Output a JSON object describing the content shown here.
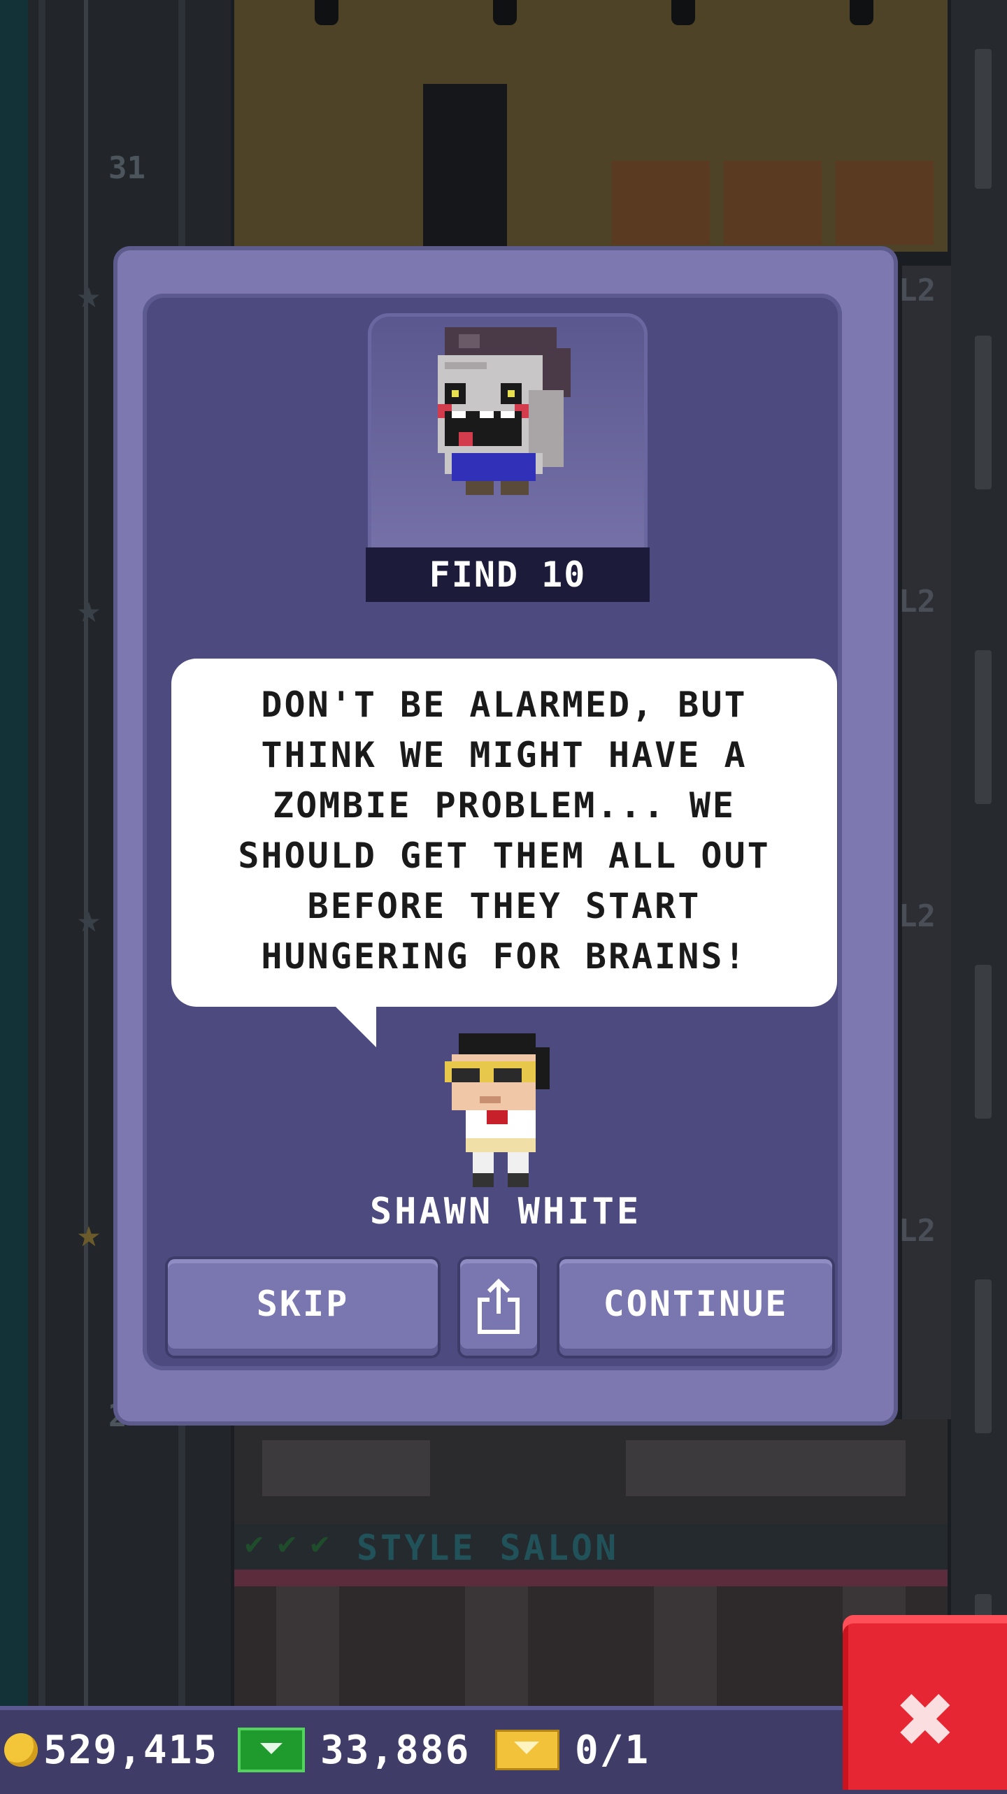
{
  "background": {
    "floor_numbers": [
      "31",
      "2"
    ],
    "level_tag": "L2",
    "room_name": "STYLE SALON"
  },
  "mission": {
    "objective": "FIND 10",
    "message": "DON'T BE ALARMED, BUT THINK WE MIGHT HAVE A ZOMBIE PROBLEM... WE SHOULD GET THEM ALL OUT BEFORE THEY START HUNGERING FOR BRAINS!",
    "speaker": "SHAWN WHITE"
  },
  "buttons": {
    "skip": "SKIP",
    "share_icon": "share-icon",
    "continue": "CONTINUE",
    "close_icon": "close-icon"
  },
  "status_bar": {
    "coins": "529,415",
    "tower_bux": "33,886",
    "tickets": "0/1"
  },
  "colors": {
    "dialog_frame": "#7d79b0",
    "dialog_panel": "#4c4a7e",
    "button": "#7a77b0",
    "close_button": "#e62632",
    "coin": "#f3c63a",
    "bux": "#1f9a2c",
    "ticket": "#f2c23a"
  }
}
